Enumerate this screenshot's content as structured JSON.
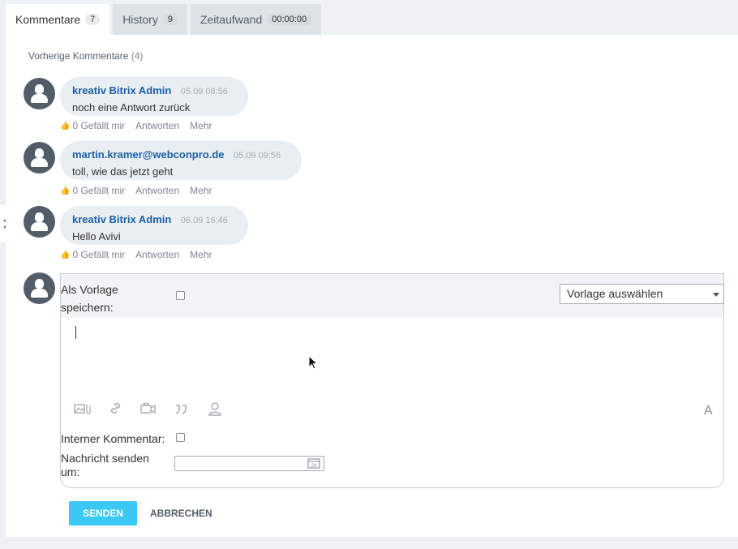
{
  "tabs": [
    {
      "label": "Kommentare",
      "count": "7"
    },
    {
      "label": "History",
      "count": "9"
    },
    {
      "label": "Zeitaufwand",
      "count": "00:00:00"
    }
  ],
  "previous": {
    "label": "Vorherige Kommentare",
    "count": "(4)"
  },
  "comments": [
    {
      "author": "kreativ Bitrix Admin",
      "time": "05.09 08:56",
      "text": "noch eine Antwort zurück"
    },
    {
      "author": "martin.kramer@webconpro.de",
      "time": "05.09 09:56",
      "text": "toll, wie das jetzt geht"
    },
    {
      "author": "kreativ Bitrix Admin",
      "time": "06.09 16:46",
      "text": "Hello Avivi"
    }
  ],
  "actions": {
    "like": "0 Gefällt mir",
    "reply": "Antworten",
    "more": "Mehr"
  },
  "form": {
    "template_label": "Als Vorlage speichern:",
    "template_select": "Vorlage auswählen",
    "internal_label": "Interner Kommentar:",
    "send_at_label": "Nachricht senden um:",
    "font_button": "A"
  },
  "buttons": {
    "send": "SENDEN",
    "cancel": "ABBRECHEN"
  },
  "icons": {
    "toolbar": [
      "image-icon",
      "link-icon",
      "video-icon",
      "quote-icon",
      "mention-icon"
    ],
    "calendar": "calendar-icon",
    "calendar_day": "24"
  },
  "colors": {
    "accent": "#3bc8f5",
    "author": "#1d5fa6",
    "avatar": "#535c69"
  }
}
